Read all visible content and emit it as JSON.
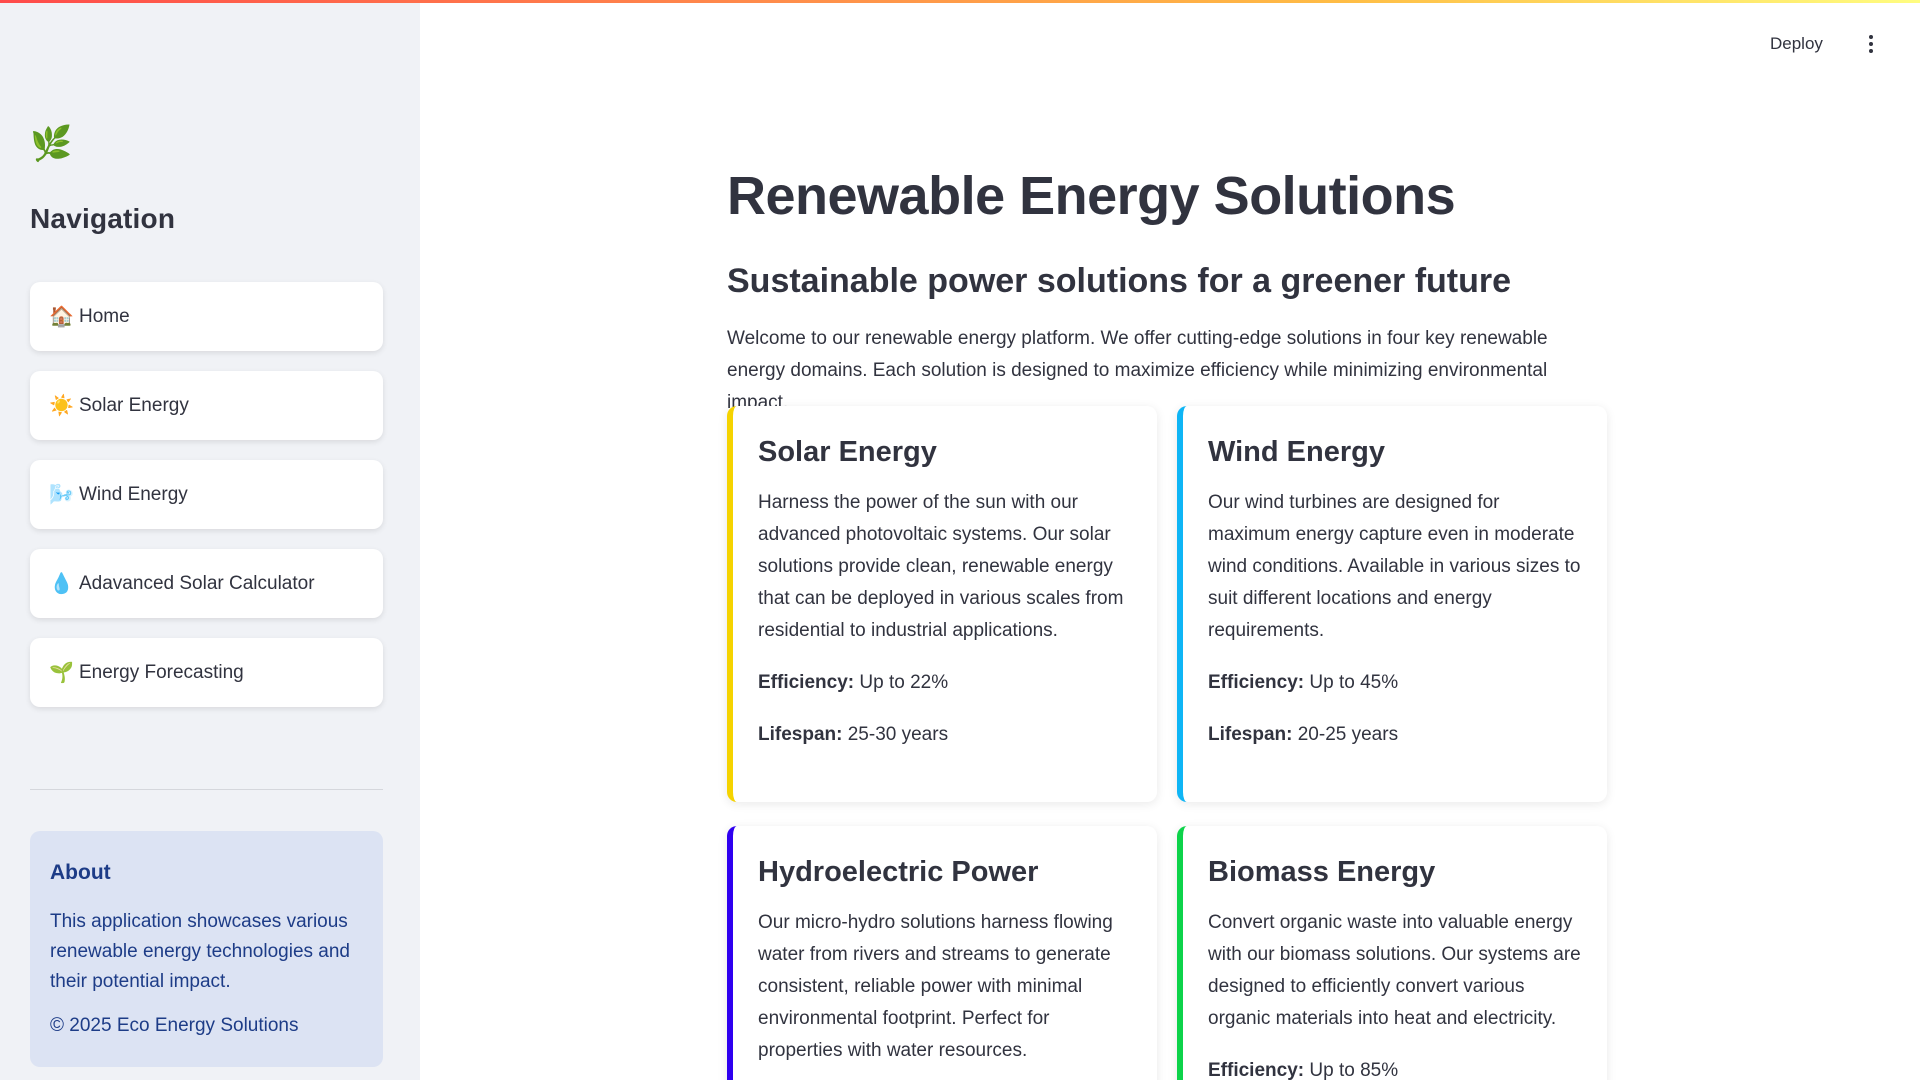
{
  "sidebar": {
    "logo": "🌿",
    "title": "Navigation",
    "items": [
      {
        "icon": "🏠",
        "label": "Home"
      },
      {
        "icon": "☀️",
        "label": "Solar Energy"
      },
      {
        "icon": "🌬️",
        "label": "Wind Energy"
      },
      {
        "icon": "💧",
        "label": "Adavanced Solar Calculator"
      },
      {
        "icon": "🌱",
        "label": "Energy Forecasting"
      }
    ],
    "about": {
      "title": "About",
      "text": "This application showcases various renewable energy technologies and their potential impact.",
      "copyright": "© 2025 Eco Energy Solutions"
    }
  },
  "header": {
    "deploy_label": "Deploy",
    "menu_icon": "vertical-dots-icon"
  },
  "main": {
    "title": "Renewable Energy Solutions",
    "subtitle": "Sustainable power solutions for a greener future",
    "intro": "Welcome to our renewable energy platform. We offer cutting-edge solutions in four key renewable energy domains. Each solution is designed to maximize efficiency while minimizing environmental impact.",
    "efficiency_label": "Efficiency:",
    "lifespan_label": "Lifespan:",
    "cards": [
      {
        "title": "Solar Energy",
        "description": "Harness the power of the sun with our advanced photovoltaic systems. Our solar solutions provide clean, renewable energy that can be deployed in various scales from residential to industrial applications.",
        "efficiency": "Up to 22%",
        "lifespan": "25-30 years",
        "accent": "#f5d300"
      },
      {
        "title": "Wind Energy",
        "description": "Our wind turbines are designed for maximum energy capture even in moderate wind conditions. Available in various sizes to suit different locations and energy requirements.",
        "efficiency": "Up to 45%",
        "lifespan": "20-25 years",
        "accent": "#0fb5f5"
      },
      {
        "title": "Hydroelectric Power",
        "description": "Our micro-hydro solutions harness flowing water from rivers and streams to generate consistent, reliable power with minimal environmental footprint. Perfect for properties with water resources.",
        "accent": "#2f00f0"
      },
      {
        "title": "Biomass Energy",
        "description": "Convert organic waste into valuable energy with our biomass solutions. Our systems are designed to efficiently convert various organic materials into heat and electricity.",
        "efficiency": "Up to 85%",
        "accent": "#0dd34a"
      }
    ]
  }
}
